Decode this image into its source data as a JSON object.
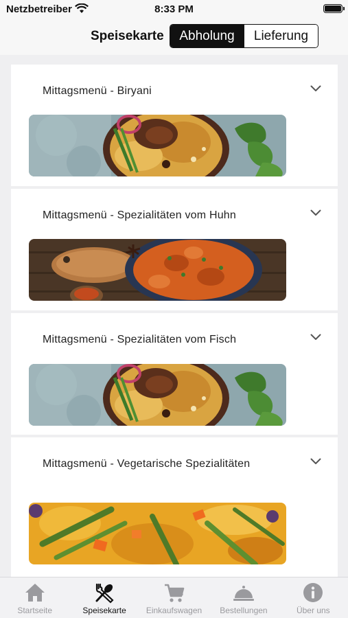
{
  "status_bar": {
    "carrier": "Netzbetreiber",
    "time": "8:33 PM"
  },
  "nav": {
    "title": "Speisekarte",
    "segments": [
      {
        "label": "Abholung",
        "selected": true
      },
      {
        "label": "Lieferung",
        "selected": false
      }
    ]
  },
  "menu": {
    "categories": [
      {
        "title": "Mittagsmenü - Biryani",
        "image": "biryani-photo"
      },
      {
        "title": "Mittagsmenü - Spezialitäten vom Huhn",
        "image": "chicken-curry-photo"
      },
      {
        "title": "Mittagsmenü - Spezialitäten vom Fisch",
        "image": "biryani-photo"
      },
      {
        "title": "Mittagsmenü - Vegetarische Spezialitäten",
        "image": "vegetable-curry-photo"
      }
    ]
  },
  "tab_bar": {
    "items": [
      {
        "label": "Startseite",
        "icon": "home-icon",
        "active": false
      },
      {
        "label": "Speisekarte",
        "icon": "cutlery-icon",
        "active": true
      },
      {
        "label": "Einkaufswagen",
        "icon": "cart-icon",
        "active": false
      },
      {
        "label": "Bestellungen",
        "icon": "cloche-icon",
        "active": false
      },
      {
        "label": "Über uns",
        "icon": "info-icon",
        "active": false
      }
    ]
  },
  "colors": {
    "active": "#111111",
    "inactive": "#9a9a9e",
    "background": "#efeff1"
  }
}
